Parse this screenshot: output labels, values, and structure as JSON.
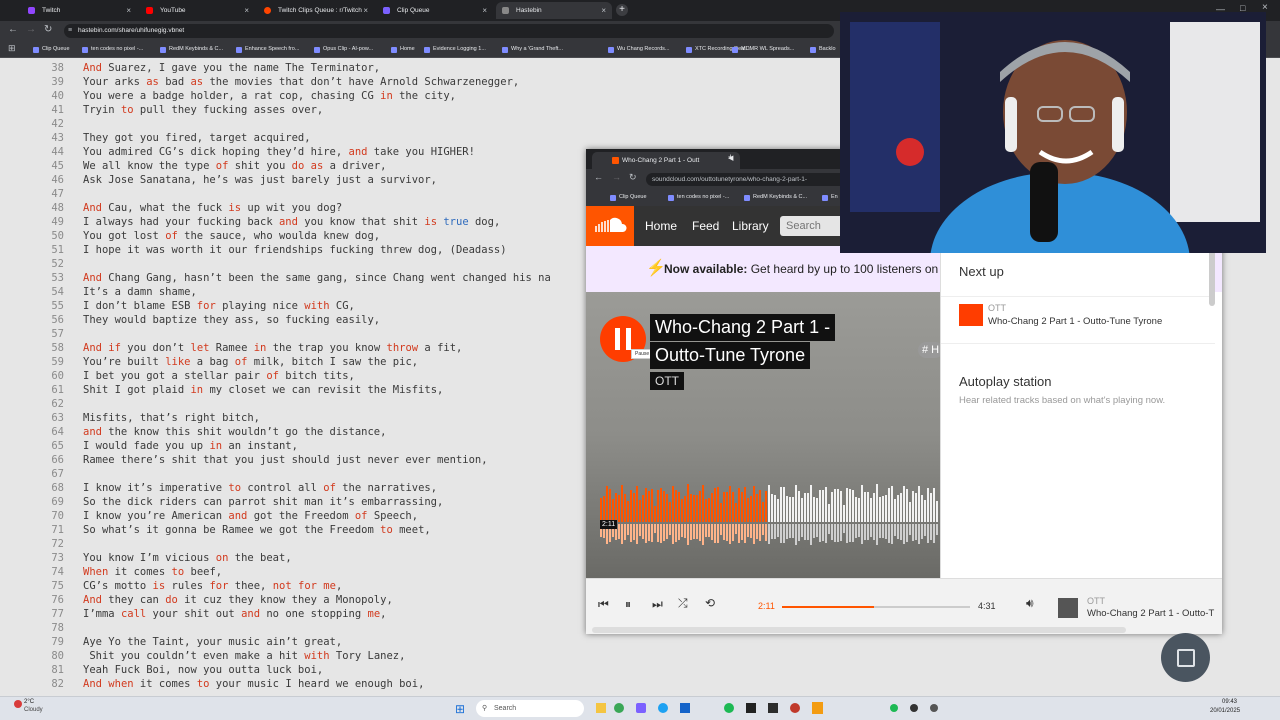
{
  "browser": {
    "tabs": [
      {
        "label": "Twitch",
        "color": "#9146ff"
      },
      {
        "label": "YouTube",
        "color": "#ff0000"
      },
      {
        "label": "Twitch Clips Queue : r/Twitch",
        "color": "#ff4500"
      },
      {
        "label": "Clip Queue",
        "color": "#7b61ff"
      },
      {
        "label": "Hastebin",
        "color": "#888888"
      }
    ],
    "url": "hastebin.com/share/uhifunegig.vbnet",
    "bookmarks": [
      "Clip Queue",
      "ten codes no pixel -...",
      "RedM Keybinds & C...",
      "Enhance Speech fro...",
      "Opus Clip - AI-pow...",
      "Home",
      "Evidence Logging 1...",
      "Why a 'Grand Theft...",
      "Wu Chang Records...",
      "XTC Recording Deal...",
      "MDMR WL Spreads...",
      "Backlo"
    ]
  },
  "editor": {
    "lines": [
      {
        "n": "38",
        "html": "<span class='k'>And</span> Suarez, I gave you the name The Terminator,"
      },
      {
        "n": "39",
        "html": "Your arks <span class='k'>as</span> bad <span class='k'>as</span> the movies that don’t have Arnold Schwarzenegger,"
      },
      {
        "n": "40",
        "html": "You were a badge holder, a rat cop, chasing CG <span class='k'>in</span> the city,"
      },
      {
        "n": "41",
        "html": "Tryin <span class='k'>to</span> pull they fucking asses over,"
      },
      {
        "n": "42",
        "html": ""
      },
      {
        "n": "43",
        "html": "They got you fired, target acquired,"
      },
      {
        "n": "44",
        "html": "You admired CG’s dick hoping they’d hire, <span class='k'>and</span> take you HIGHER!"
      },
      {
        "n": "45",
        "html": "We all know the type <span class='k'>of</span> shit you <span class='k'>do</span> <span class='k'>as</span> a driver,"
      },
      {
        "n": "46",
        "html": "Ask Jose Sanatana, he’s was just barely just a survivor,"
      },
      {
        "n": "47",
        "html": ""
      },
      {
        "n": "48",
        "html": "<span class='k'>And</span> Cau, what the fuck <span class='k'>is</span> up wit you dog?"
      },
      {
        "n": "49",
        "html": "I always had your fucking back <span class='k'>and</span> you know that shit <span class='k'>is</span> <span class='b'>true</span> dog,"
      },
      {
        "n": "50",
        "html": "You got lost <span class='k'>of</span> the sauce, who woulda knew dog,"
      },
      {
        "n": "51",
        "html": "I hope it was worth it our friendships fucking threw dog, (Deadass)"
      },
      {
        "n": "52",
        "html": ""
      },
      {
        "n": "53",
        "html": "<span class='k'>And</span> Chang Gang, hasn’t been the same gang, since Chang went changed his na"
      },
      {
        "n": "54",
        "html": "It’s a damn shame,"
      },
      {
        "n": "55",
        "html": "I don’t blame ESB <span class='k'>for</span> playing nice <span class='k'>with</span> CG,"
      },
      {
        "n": "56",
        "html": "They would baptize they ass, so fucking easily,"
      },
      {
        "n": "57",
        "html": ""
      },
      {
        "n": "58",
        "html": "<span class='k'>And</span> <span class='k'>if</span> you don’t <span class='k'>let</span> Ramee <span class='k'>in</span> the trap you know <span class='k'>throw</span> a fit,"
      },
      {
        "n": "59",
        "html": "You’re built <span class='k'>like</span> a bag <span class='k'>of</span> milk, bitch I saw the pic,"
      },
      {
        "n": "60",
        "html": "I bet you got a stellar pair <span class='k'>of</span> bitch tits,"
      },
      {
        "n": "61",
        "html": "Shit I got plaid <span class='k'>in</span> my closet we can revisit the Misfits,"
      },
      {
        "n": "62",
        "html": ""
      },
      {
        "n": "63",
        "html": "Misfits, that’s right bitch,"
      },
      {
        "n": "64",
        "html": "<span class='k'>and</span> the know this shit wouldn’t go the distance,"
      },
      {
        "n": "65",
        "html": "I would fade you up <span class='k'>in</span> an instant,"
      },
      {
        "n": "66",
        "html": "Ramee there’s shit that you just should just never ever mention,"
      },
      {
        "n": "67",
        "html": ""
      },
      {
        "n": "68",
        "html": "I know it’s imperative <span class='k'>to</span> control all <span class='k'>of</span> the narratives,"
      },
      {
        "n": "69",
        "html": "So the dick riders can parrot shit man it’s embarrassing,"
      },
      {
        "n": "70",
        "html": "I know you’re American <span class='k'>and</span> got the Freedom <span class='k'>of</span> Speech,"
      },
      {
        "n": "71",
        "html": "So what’s it gonna be Ramee we got the Freedom <span class='k'>to</span> meet,"
      },
      {
        "n": "72",
        "html": ""
      },
      {
        "n": "73",
        "html": "You know I’m vicious <span class='k'>on</span> the beat,"
      },
      {
        "n": "74",
        "html": "<span class='k'>When</span> it comes <span class='k'>to</span> beef,"
      },
      {
        "n": "75",
        "html": "CG’s motto <span class='k'>is</span> rules <span class='k'>for</span> thee, <span class='k'>not</span> <span class='k'>for</span> <span class='k'>me</span>,"
      },
      {
        "n": "76",
        "html": "<span class='k'>And</span> they can <span class='k'>do</span> it cuz they know they a Monopoly,"
      },
      {
        "n": "77",
        "html": "I’mma <span class='k'>call</span> your shit out <span class='k'>and</span> no one stopping <span class='k'>me</span>,"
      },
      {
        "n": "78",
        "html": ""
      },
      {
        "n": "79",
        "html": "Aye Yo the Taint, your music ain’t great,"
      },
      {
        "n": "80",
        "html": " Shit you couldn’t even make a hit <span class='k'>with</span> Tory Lanez,"
      },
      {
        "n": "81",
        "html": "Yeah Fuck Boi, now you outta luck boi,"
      },
      {
        "n": "82",
        "html": "<span class='k'>And</span> <span class='k'>when</span> it comes <span class='k'>to</span> your music I heard we enough boi,"
      }
    ]
  },
  "soundcloud": {
    "tab_label": "Who-Chang 2 Part 1 - Outt",
    "url": "soundcloud.com/outtotunetyrone/who-chang-2-part-1-",
    "bookmarks": [
      "Clip Queue",
      "ten codes no pixel -...",
      "RedM Keybinds & C...",
      "En"
    ],
    "nav": [
      "Home",
      "Feed",
      "Library"
    ],
    "search_placeholder": "Search",
    "banner_bold": "Now available:",
    "banner_text": "Get heard by up to 100 listeners on y",
    "track_title_1": "Who-Chang 2 Part 1 -",
    "track_title_2": "Outto-Tune Tyrone",
    "artist": "OTT",
    "pause_tooltip": "Pause",
    "tag": "# H",
    "waveform_time": "2:11",
    "progress": 0.49,
    "sidebar": {
      "next_up": "Next up",
      "next_artist": "OTT",
      "next_title": "Who-Chang 2 Part 1 - Outto-Tune Tyrone",
      "autoplay_title": "Autoplay station",
      "autoplay_desc": "Hear related tracks based on what's playing now."
    },
    "player": {
      "elapsed": "2:11",
      "duration": "4:31",
      "artist": "OTT",
      "title": "Who-Chang 2 Part 1 - Outto-T"
    }
  },
  "taskbar": {
    "weather_temp": "2°C",
    "weather_desc": "Cloudy",
    "search_placeholder": "Search",
    "time": "09:43",
    "date": "20/01/2025"
  }
}
